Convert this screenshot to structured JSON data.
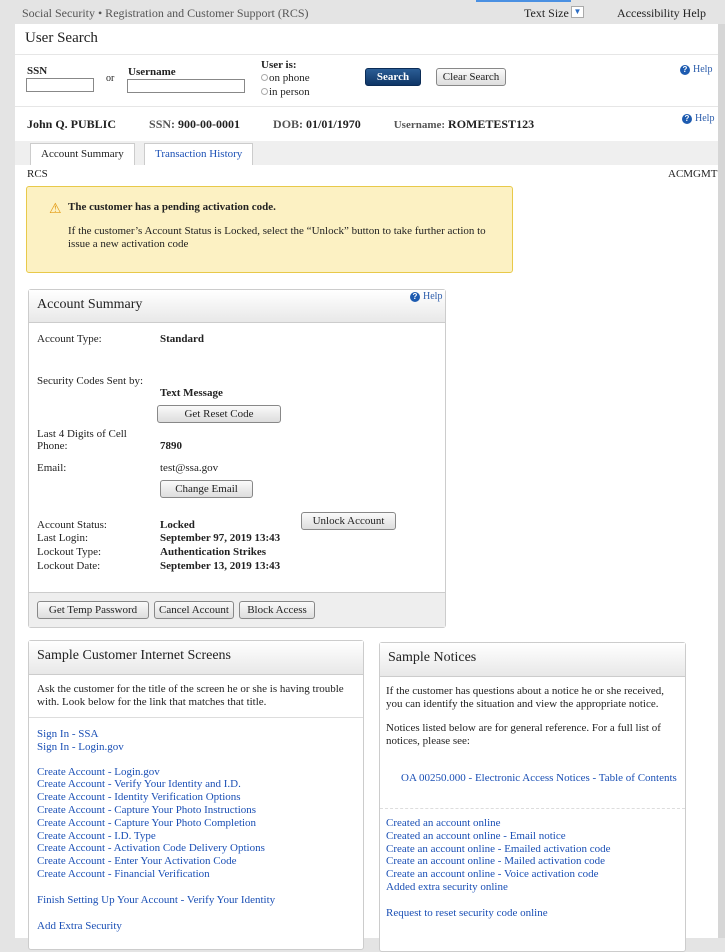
{
  "header": {
    "app_title": "Social Security • Registration and Customer Support (RCS)",
    "text_size": "Text Size",
    "accessibility_help": "Accessibility Help"
  },
  "search": {
    "title": "User Search",
    "ssn_label": "SSN",
    "or": "or",
    "username_label": "Username",
    "ssn_value": "",
    "username_value": "",
    "user_is_label": "User is:",
    "on_phone": "on phone",
    "in_person": "in person",
    "search_button": "Search",
    "clear_button": "Clear Search",
    "help": "Help"
  },
  "customer": {
    "name": "John Q. PUBLIC",
    "ssn_label": "SSN:",
    "ssn": "900-00-0001",
    "dob_label": "DOB:",
    "dob": "01/01/1970",
    "username_label": "Username:",
    "username": "ROMETEST123",
    "help": "Help"
  },
  "tabs": [
    {
      "label": "Account Summary"
    },
    {
      "label": "Transaction History"
    }
  ],
  "context": {
    "left": "RCS",
    "right": "ACMGMT"
  },
  "alert": {
    "title": "The customer has a pending activation code.",
    "body": "If the customer’s Account Status is Locked, select the “Unlock” button to take further action to issue a new activation code"
  },
  "account": {
    "title": "Account Summary",
    "help": "Help",
    "type_label": "Account Type:",
    "type": "Standard",
    "codes_label": "Security Codes Sent by:",
    "codes": "Text Message",
    "reset_button": "Get Reset Code",
    "cell_label": "Last 4 Digits of Cell Phone:",
    "cell": "7890",
    "email_label": "Email:",
    "email": "test@ssa.gov",
    "change_email_button": "Change Email",
    "status_label": "Account Status:",
    "status": "Locked",
    "unlock_button": "Unlock Account",
    "last_login_label": "Last Login:",
    "last_login": "September 97, 2019 13:43",
    "lockout_type_label": "Lockout Type:",
    "lockout_type": "Authentication Strikes",
    "lockout_date_label": "Lockout Date:",
    "lockout_date": "September 13, 2019 13:43",
    "temp_password_button": "Get Temp Password",
    "cancel_button": "Cancel Account",
    "block_button": "Block Access"
  },
  "screens": {
    "title": "Sample Customer Internet Screens",
    "intro": "Ask the customer for the title of the screen he or she is having trouble with. Look below for the link that matches that title.",
    "group1": [
      "Sign In - SSA",
      "Sign In - Login.gov"
    ],
    "group2": [
      "Create Account - Login.gov",
      "Create Account - Verify Your Identity and I.D.",
      "Create Account - Identity Verification Options",
      "Create Account - Capture Your Photo Instructions",
      "Create Account - Capture Your Photo Completion",
      "Create Account - I.D. Type",
      "Create Account - Activation Code Delivery Options",
      "Create Account - Enter Your Activation Code",
      "Create Account - Financial Verification"
    ],
    "group3": [
      "Finish Setting Up Your Account - Verify Your Identity"
    ],
    "group4": [
      "Add Extra Security"
    ]
  },
  "notices": {
    "title": "Sample Notices",
    "intro1": "If the customer has questions about a notice he or she received, you can identify the situation and view the appropriate notice.",
    "intro2": "Notices listed below are for general reference. For a full list of notices, please see:",
    "toc_link": "OA 00250.000 - Electronic Access Notices - Table of Contents",
    "group1": [
      "Created an account online",
      "Created an account online - Email notice",
      "Create an account online - Emailed activation code",
      "Create an account online - Mailed activation code",
      "Create an account online - Voice activation code",
      "Added extra security online"
    ],
    "group2": [
      "Request to reset security code online"
    ]
  }
}
